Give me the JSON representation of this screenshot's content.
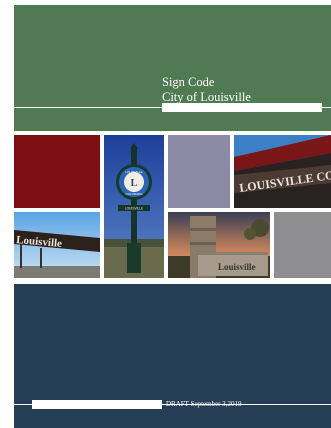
{
  "cover": {
    "title": "Sign Code",
    "subtitle": "City of Louisville",
    "draft_label": "DRAFT September 3,2019"
  },
  "photos": {
    "clock_sign_text": "LOUISVILLE",
    "clock_sign_state": "COLORADO",
    "clock_sign_letter": "L",
    "clock_sign_plaque": "LOUISVILLE",
    "building_sign_text": "LOUISVILLE CO",
    "arch_sign_text": "Louisville",
    "stone_sign_text": "Louisville"
  },
  "colors": {
    "green_band": "#4f7a52",
    "red_tile": "#7d0f12",
    "lavender_tile": "#8d8aa6",
    "gray_tile": "#8f8f92",
    "navy_band": "#253d55"
  }
}
